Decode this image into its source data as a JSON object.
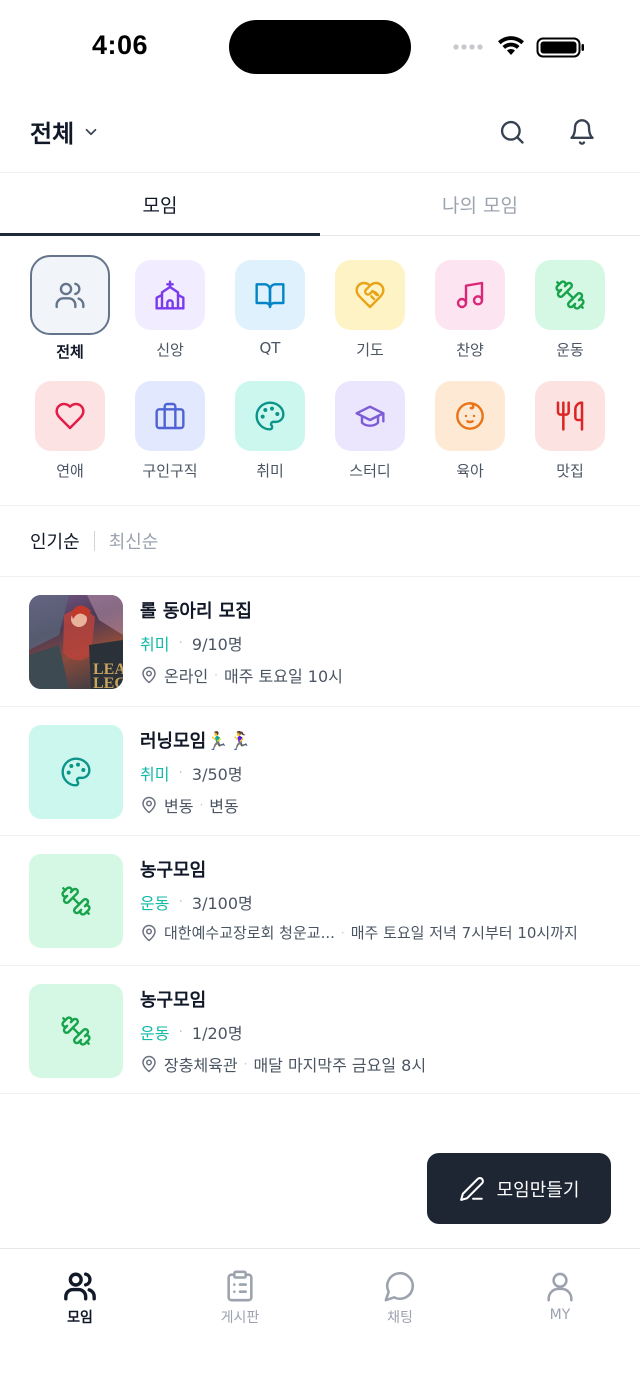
{
  "status_bar": {
    "time": "4:06"
  },
  "header": {
    "region_label": "전체",
    "icons": [
      "search-icon",
      "bell-icon"
    ]
  },
  "tabs": [
    {
      "label": "모임",
      "active": true
    },
    {
      "label": "나의 모임",
      "active": false
    }
  ],
  "categories": [
    {
      "label": "전체",
      "icon": "users-icon",
      "selected": true,
      "bg": "#f1f5f9",
      "color": "#64748b"
    },
    {
      "label": "신앙",
      "icon": "church-icon",
      "bg": "#f1ecff",
      "color": "#7c3aed"
    },
    {
      "label": "QT",
      "icon": "book-icon",
      "bg": "#dff1fd",
      "color": "#0284c7"
    },
    {
      "label": "기도",
      "icon": "heart-handshake-icon",
      "bg": "#fdf3c4",
      "color": "#e8a317"
    },
    {
      "label": "찬양",
      "icon": "music-icon",
      "bg": "#fde4f1",
      "color": "#db2777"
    },
    {
      "label": "운동",
      "icon": "dumbbell-icon",
      "bg": "#d5f8e4",
      "color": "#16a34a"
    },
    {
      "label": "연애",
      "icon": "heart-icon",
      "bg": "#fde2e4",
      "color": "#e11d48"
    },
    {
      "label": "구인구직",
      "icon": "briefcase-icon",
      "bg": "#e2e8fd",
      "color": "#4f63d2"
    },
    {
      "label": "취미",
      "icon": "palette-icon",
      "bg": "#ccf7ef",
      "color": "#0d9488"
    },
    {
      "label": "스터디",
      "icon": "graduation-cap-icon",
      "bg": "#ebe5fd",
      "color": "#7c5cd6"
    },
    {
      "label": "육아",
      "icon": "baby-icon",
      "bg": "#fde9d4",
      "color": "#ea7317"
    },
    {
      "label": "맛집",
      "icon": "utensils-icon",
      "bg": "#fde2e2",
      "color": "#dc2626"
    }
  ],
  "sort": {
    "options": [
      "인기순",
      "최신순"
    ],
    "active": "인기순"
  },
  "meetups": [
    {
      "title": "롤 동아리 모집",
      "category": "취미",
      "members": "9/10명",
      "location": "온라인",
      "schedule": "매주 토요일 10시",
      "thumb_type": "photo",
      "photo_text": "LEAG\nLEGE"
    },
    {
      "title": "러닝모임🏃‍♂️🏃‍♀️",
      "category": "취미",
      "members": "3/50명",
      "location": "변동",
      "schedule": "변동",
      "thumb_type": "icon",
      "icon": "palette-icon",
      "bg": "#ccf7ef",
      "color": "#0d9488"
    },
    {
      "title": "농구모임",
      "category": "운동",
      "members": "3/100명",
      "location": "대한예수교장로회 청운교...",
      "schedule": "매주 토요일 저녁 7시부터 10시까지",
      "thumb_type": "icon",
      "icon": "dumbbell-icon",
      "bg": "#d5f8e4",
      "color": "#16a34a"
    },
    {
      "title": "농구모임",
      "category": "운동",
      "members": "1/20명",
      "location": "장충체육관",
      "schedule": "매달 마지막주 금요일 8시",
      "thumb_type": "icon",
      "icon": "dumbbell-icon",
      "bg": "#d5f8e4",
      "color": "#16a34a"
    }
  ],
  "fab": {
    "label": "모임만들기",
    "icon": "pencil-icon"
  },
  "bottom_nav": [
    {
      "label": "모임",
      "icon": "users-icon",
      "active": true
    },
    {
      "label": "게시판",
      "icon": "clipboard-icon",
      "active": false
    },
    {
      "label": "채팅",
      "icon": "chat-icon",
      "active": false
    },
    {
      "label": "MY",
      "icon": "user-icon",
      "active": false
    }
  ]
}
